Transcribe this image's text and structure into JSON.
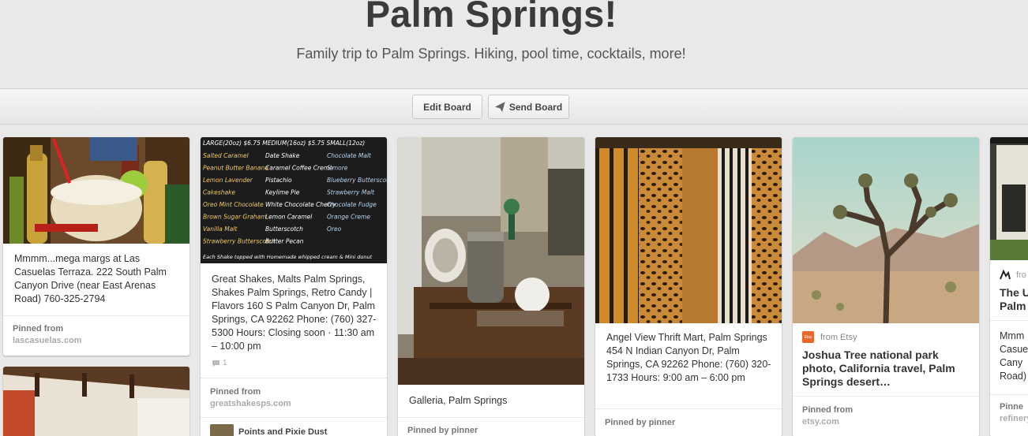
{
  "board": {
    "title": "Palm Springs!",
    "description": "Family trip to Palm Springs. Hiking, pool time, cocktails, more!"
  },
  "toolbar": {
    "edit_label": "Edit Board",
    "send_label": "Send Board"
  },
  "pins": [
    {
      "description": "Mmmm...mega margs at Las Casuelas Terraza. 222 South Palm Canyon Drive (near East Arenas Road) 760-325-2794",
      "pinned_label": "Pinned from",
      "source": "lascasuelas.com"
    },
    {
      "description": "Great Shakes, Malts Palm Springs, Shakes Palm Springs, Retro Candy | Flavors 160 S Palm Canyon Dr, Palm Springs, CA 92262 Phone: (760) 327-5300 Hours: Closing soon · 11:30 am – 10:00 pm",
      "comment_count": "1",
      "pinned_label": "Pinned from",
      "source": "greatshakesps.com",
      "board_user": "Points and Pixie Dust",
      "menu": {
        "line1": "LARGE(20oz) $6.75  MEDIUM(16oz) $5.75  SMALL(12oz)",
        "col1": [
          "Salted Caramel",
          "Peanut Butter Banana",
          "Lemon Lavender",
          "Cakeshake",
          "Oreo Mint Chocolate",
          "Brown Sugar Graham",
          "Vanilla Malt",
          "Strawberry Butterscotch"
        ],
        "col2": [
          "Date Shake",
          "Caramel Coffee Creme",
          "Pistachio",
          "Keylime Pie",
          "White Chocolate Cherry",
          "Lemon Caramel",
          "Butterscotch",
          "Butter Pecan"
        ],
        "col3": [
          "Chocolate Malt",
          "S'more",
          "Blueberry Butterscotch",
          "Strawberry Malt",
          "Chocolate Fudge",
          "Orange Creme",
          "Oreo"
        ],
        "footer": "Each Shake topped with Homemade whipped cream & Mini donut"
      }
    },
    {
      "description": "Galleria, Palm Springs",
      "pinned_label": "Pinned by pinner"
    },
    {
      "description": "Angel View Thrift Mart, Palm Springs 454 N Indian Canyon Dr, Palm Springs, CA 92262 Phone: (760) 320-1733 Hours: 9:00 am – 6:00 pm",
      "pinned_label": "Pinned by pinner"
    },
    {
      "from_label": "from Etsy",
      "badge": "Etsy",
      "title": "Joshua Tree national park photo, California travel, Palm Springs desert…",
      "pinned_label": "Pinned from",
      "source": "etsy.com"
    },
    {
      "from_label": "fro",
      "title_lines": [
        "The U",
        "Palm"
      ],
      "desc_lines": [
        "Mmm",
        "Casue",
        "Cany",
        "Road)"
      ],
      "pinned_label": "Pinne",
      "source": "refinery"
    }
  ],
  "colors": {
    "background": "#e9e9e9",
    "title": "#3b3b3b",
    "etsy_orange": "#e8672a"
  }
}
